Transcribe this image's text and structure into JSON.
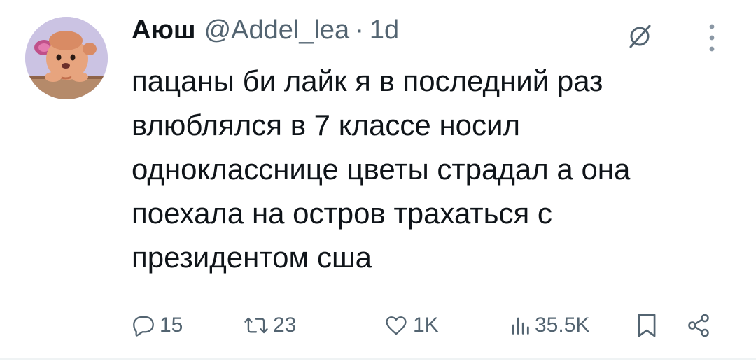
{
  "author": {
    "display_name": "Аюш",
    "handle": "@Addel_lea",
    "separator": "·",
    "time": "1d",
    "avatar_icon": "cartoon-avatar"
  },
  "tweet": {
    "text": "пацаны би лайк я в последний раз\nвлюблялся в 7 классе носил\nоднокласснице цветы страдал а она\nпоехала на остров трахаться с\nпрезидентом сша"
  },
  "actions": {
    "reply_count": "15",
    "retweet_count": "23",
    "like_count": "1K",
    "views_count": "35.5K"
  },
  "icons": {
    "grok": "grok-icon",
    "more": "more-vertical-icon",
    "reply": "reply-icon",
    "retweet": "retweet-icon",
    "like": "heart-icon",
    "views": "views-icon",
    "bookmark": "bookmark-icon",
    "share": "share-icon"
  },
  "colors": {
    "text": "#0f1419",
    "secondary": "#536471",
    "divider": "#eff3f4"
  }
}
